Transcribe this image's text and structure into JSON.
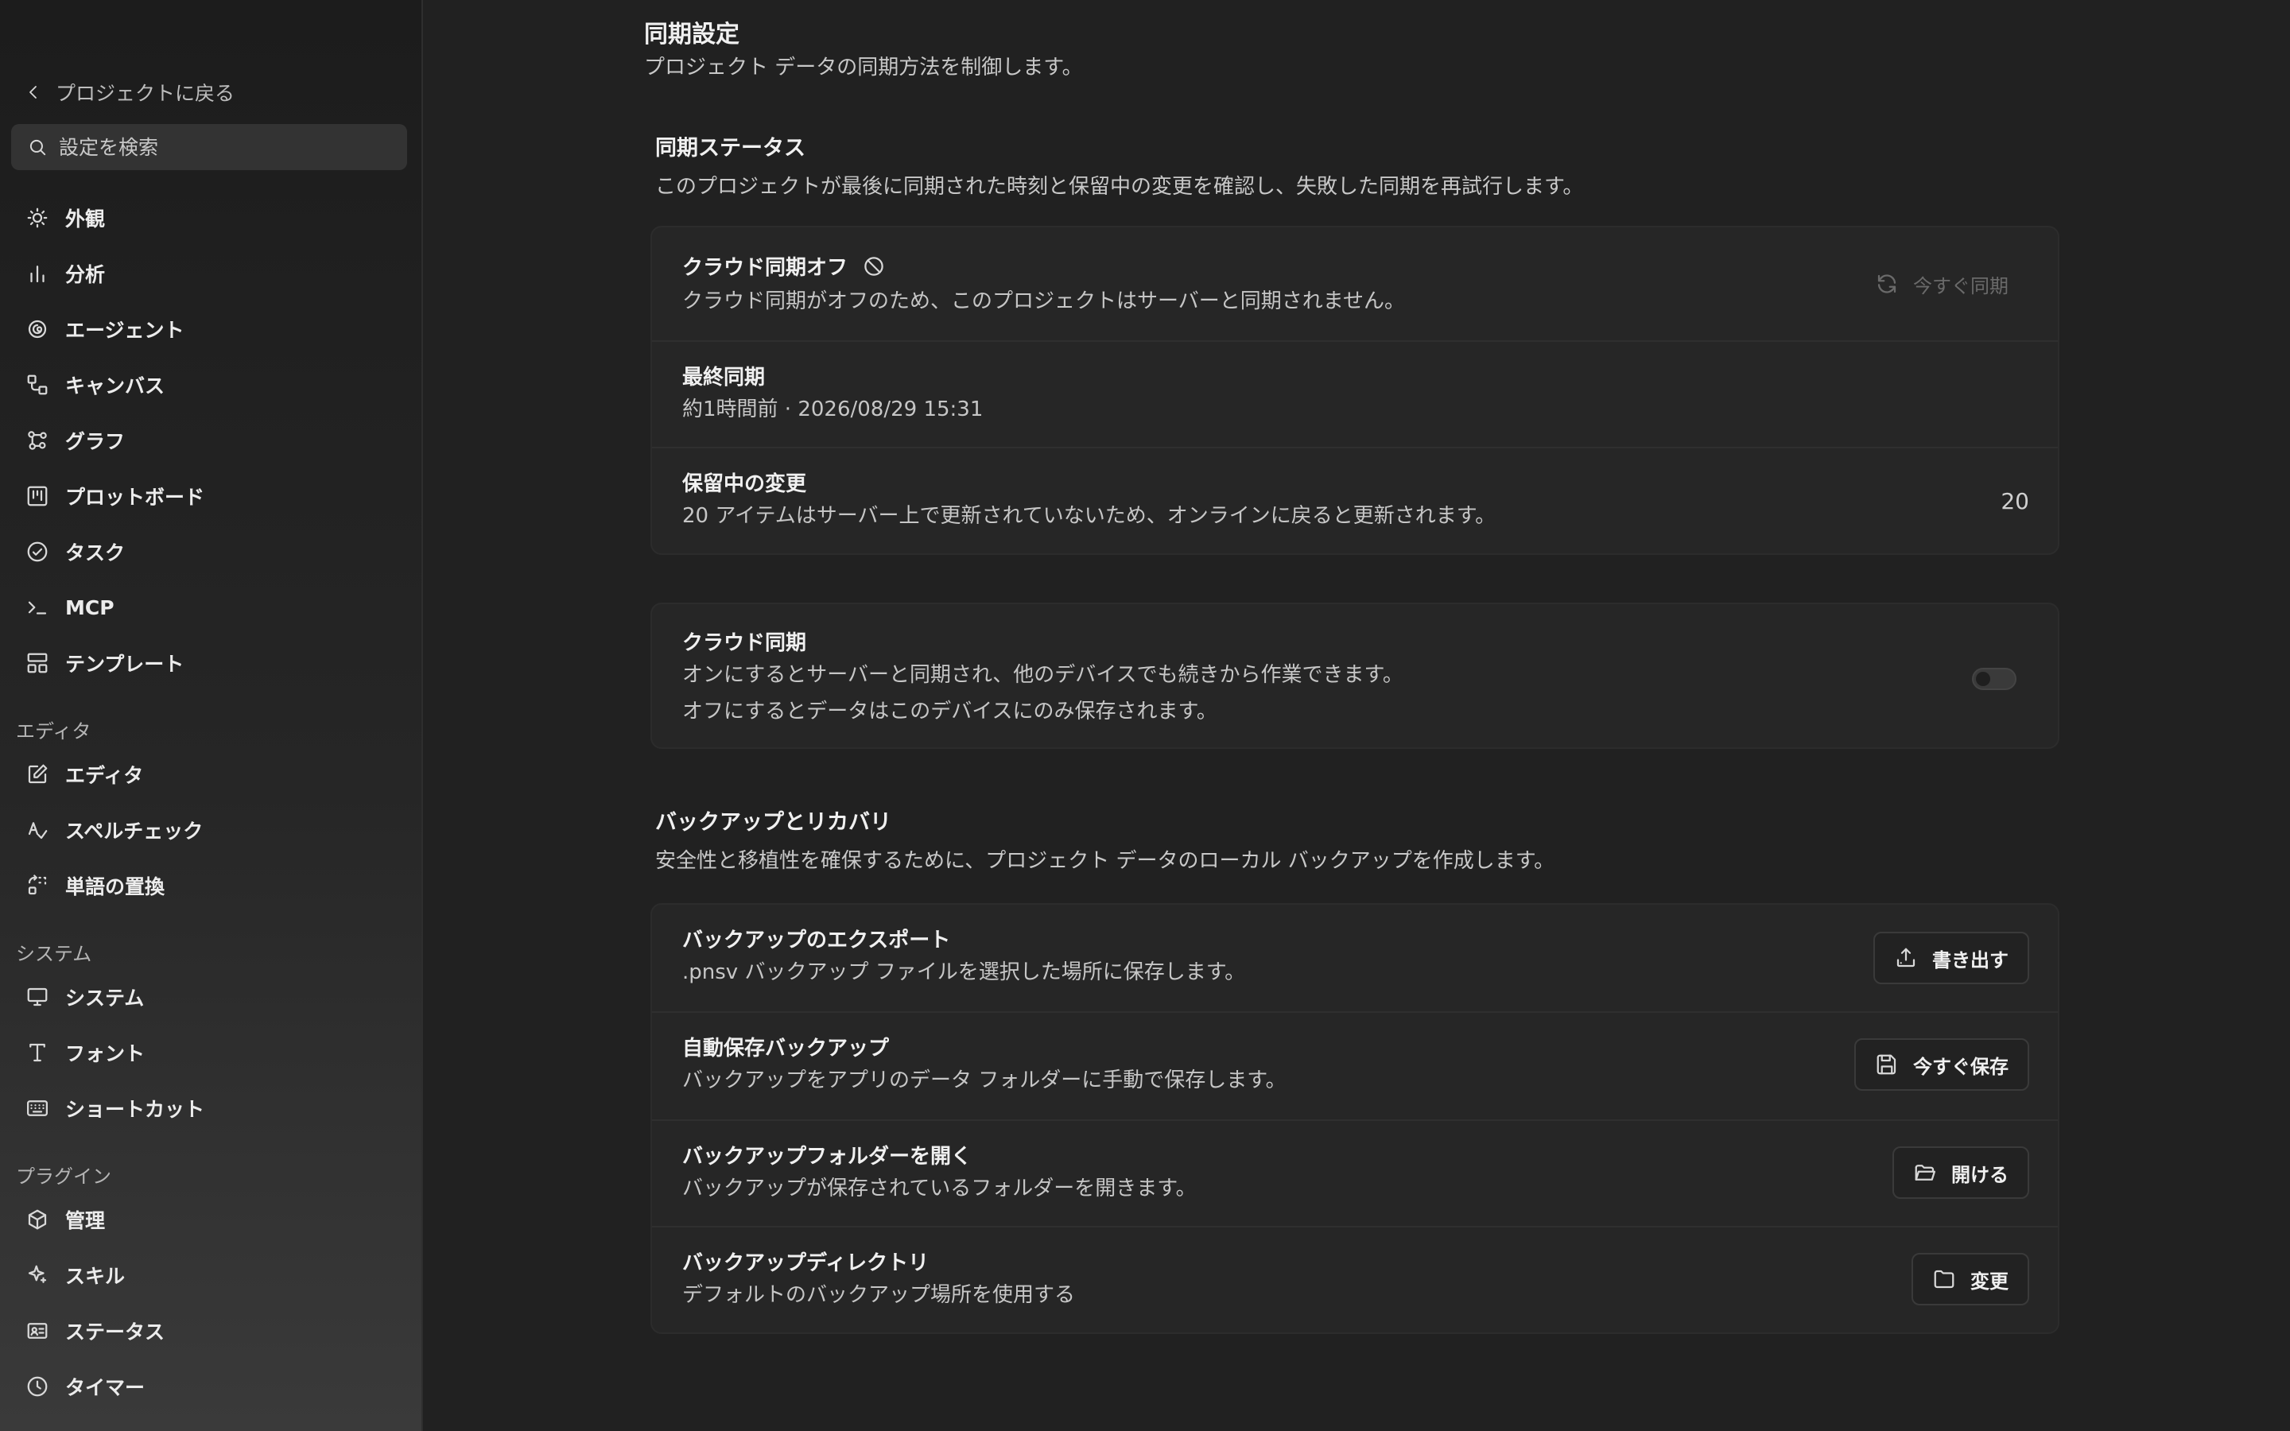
{
  "sidebar": {
    "back_label": "プロジェクトに戻る",
    "search_placeholder": "設定を検索",
    "items": [
      {
        "label": "外観",
        "icon": "sun-icon"
      },
      {
        "label": "分析",
        "icon": "bar-chart-icon"
      },
      {
        "label": "エージェント",
        "icon": "spiral-icon"
      },
      {
        "label": "キャンバス",
        "icon": "canvas-icon"
      },
      {
        "label": "グラフ",
        "icon": "graph-icon"
      },
      {
        "label": "プロットボード",
        "icon": "kanban-icon"
      },
      {
        "label": "タスク",
        "icon": "check-circle-icon"
      },
      {
        "label": "MCP",
        "icon": "terminal-icon"
      },
      {
        "label": "テンプレート",
        "icon": "layout-icon"
      }
    ],
    "groups": {
      "editor": {
        "label": "エディタ",
        "items": [
          {
            "label": "エディタ",
            "icon": "edit-icon"
          },
          {
            "label": "スペルチェック",
            "icon": "spellcheck-icon"
          },
          {
            "label": "単語の置換",
            "icon": "replace-icon"
          }
        ]
      },
      "system": {
        "label": "システム",
        "items": [
          {
            "label": "システム",
            "icon": "monitor-icon"
          },
          {
            "label": "フォント",
            "icon": "type-icon"
          },
          {
            "label": "ショートカット",
            "icon": "keyboard-icon"
          }
        ]
      },
      "plugins": {
        "label": "プラグイン",
        "items": [
          {
            "label": "管理",
            "icon": "package-icon"
          },
          {
            "label": "スキル",
            "icon": "sparkles-icon"
          },
          {
            "label": "ステータス",
            "icon": "id-card-icon"
          },
          {
            "label": "タイマー",
            "icon": "clock-icon"
          }
        ]
      }
    }
  },
  "main": {
    "title": "同期設定",
    "subtitle": "プロジェクト データの同期方法を制御します。",
    "sync_status": {
      "title": "同期ステータス",
      "description": "このプロジェクトが最後に同期された時刻と保留中の変更を確認し、失敗した同期を再試行します。",
      "cloud_off": {
        "title": "クラウド同期オフ",
        "description": "クラウド同期がオフのため、このプロジェクトはサーバーと同期されません。",
        "button": "今すぐ同期"
      },
      "last_sync": {
        "title": "最終同期",
        "value": "約1時間前 · 2026/08/29 15:31"
      },
      "pending": {
        "title": "保留中の変更",
        "description": "20 アイテムはサーバー上で更新されていないため、オンラインに戻ると更新されます。",
        "count": "20"
      }
    },
    "cloud_sync": {
      "title": "クラウド同期",
      "description_on": "オンにするとサーバーと同期され、他のデバイスでも続きから作業できます。",
      "description_off": "オフにするとデータはこのデバイスにのみ保存されます。",
      "enabled": false
    },
    "backup": {
      "title": "バックアップとリカバリ",
      "description": "安全性と移植性を確保するために、プロジェクト データのローカル バックアップを作成します。",
      "export": {
        "title": "バックアップのエクスポート",
        "description": ".pnsv バックアップ ファイルを選択した場所に保存します。",
        "button": "書き出す"
      },
      "autosave": {
        "title": "自動保存バックアップ",
        "description": "バックアップをアプリのデータ フォルダーに手動で保存します。",
        "button": "今すぐ保存"
      },
      "open_folder": {
        "title": "バックアップフォルダーを開く",
        "description": "バックアップが保存されているフォルダーを開きます。",
        "button": "開ける"
      },
      "directory": {
        "title": "バックアップディレクトリ",
        "description": "デフォルトのバックアップ場所を使用する",
        "button": "変更"
      }
    }
  }
}
